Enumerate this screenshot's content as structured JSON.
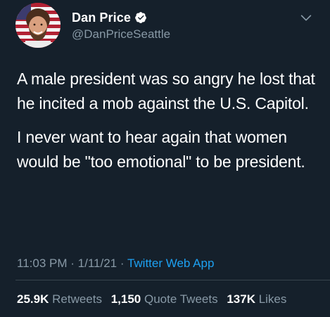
{
  "author": {
    "display_name": "Dan Price",
    "handle": "@DanPriceSeattle",
    "verified": true,
    "avatar_icon": "profile-photo",
    "verified_icon": "verified-badge-icon"
  },
  "tweet": {
    "paragraphs": [
      "A male president was so angry he lost that he incited a mob against the U.S. Capitol.",
      "I never want to hear again that women would be \"too emotional\" to be president."
    ]
  },
  "meta": {
    "time": "11:03 PM",
    "separator": "·",
    "date": "1/11/21",
    "source": "Twitter Web App"
  },
  "stats": {
    "retweets_count": "25.9K",
    "retweets_label": "Retweets",
    "quote_count": "1,150",
    "quote_label": "Quote Tweets",
    "likes_count": "137K",
    "likes_label": "Likes"
  },
  "colors": {
    "background": "#15202b",
    "text_primary": "#ffffff",
    "text_secondary": "#8899a6",
    "accent": "#1da1f2",
    "divider": "#38444d"
  }
}
